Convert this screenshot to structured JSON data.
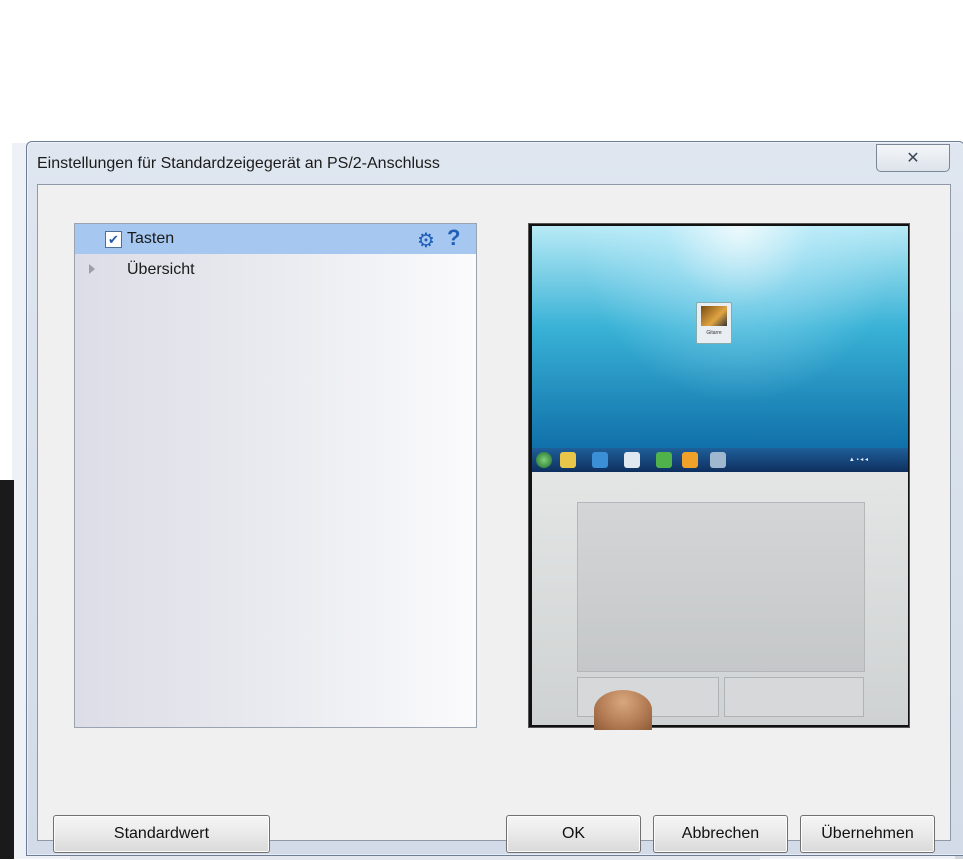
{
  "dialog": {
    "title": "Einstellungen für Standardzeigegerät an PS/2-Anschluss",
    "close_icon": "close-icon"
  },
  "tree": {
    "items": [
      {
        "label": "Tasten",
        "checked": true,
        "selected": true
      },
      {
        "label": "Übersicht",
        "expandable": true
      }
    ],
    "icons": [
      "gear-icon",
      "help-icon"
    ]
  },
  "preview": {
    "desktop_icon_label": "Gitarre"
  },
  "buttons": {
    "default_label": "Standardwert",
    "ok_label": "OK",
    "cancel_label": "Abbrechen",
    "apply_label": "Übernehmen"
  },
  "colors": {
    "selection": "#a6c7f0",
    "accent_icon": "#1f5fb6"
  }
}
